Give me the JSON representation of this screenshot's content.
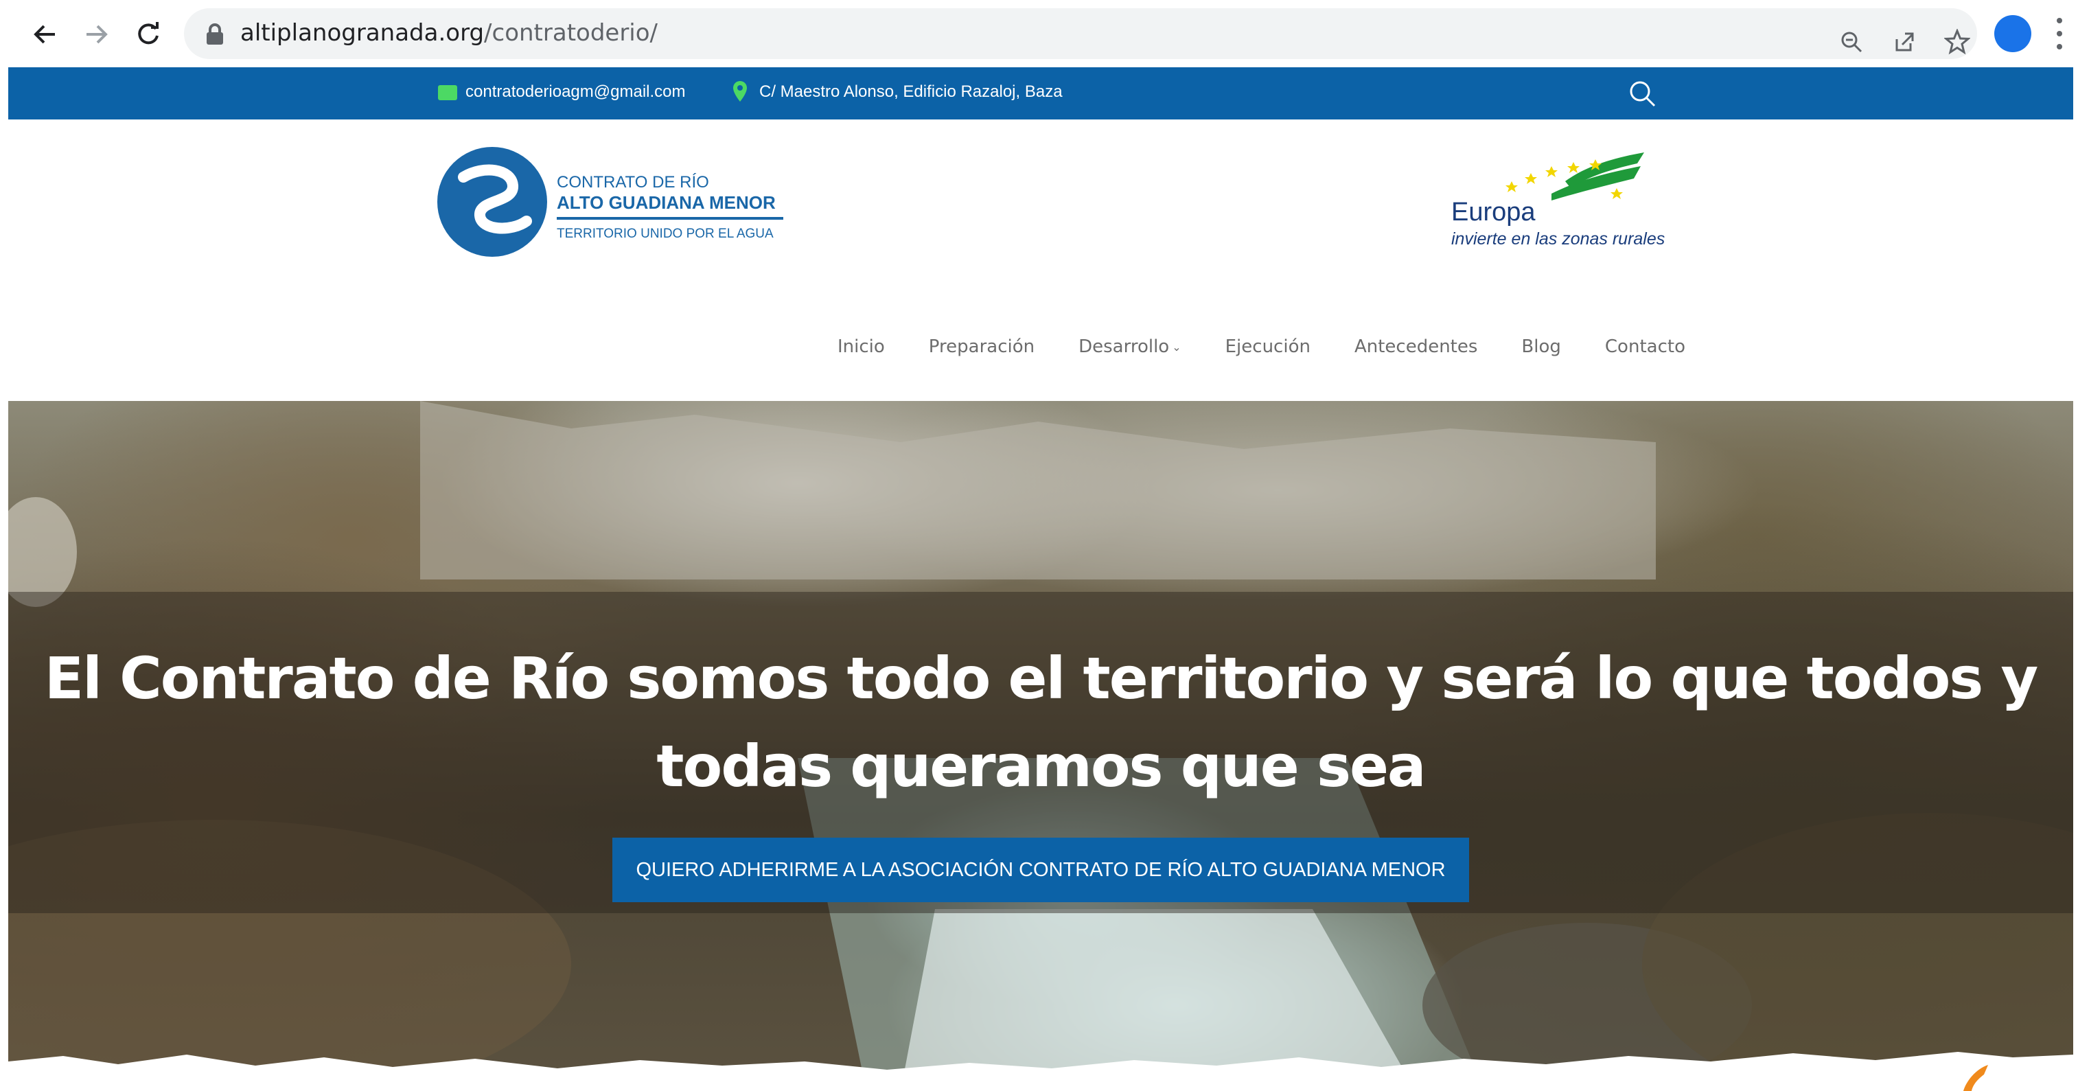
{
  "browser": {
    "url_host": "altiplanogranada.org",
    "url_path": "/contratoderio/",
    "icons": [
      "back-arrow-icon",
      "forward-arrow-icon",
      "reload-icon",
      "lock-icon",
      "zoom-icon",
      "share-icon",
      "star-icon",
      "profile-avatar",
      "menu-dots-icon"
    ]
  },
  "topbar": {
    "email": "contratoderioagm@gmail.com",
    "address": "C/ Maestro Alonso, Edificio Razaloj, Baza",
    "bg_color": "#0c62a7"
  },
  "logo": {
    "line1": "CONTRATO DE RÍO",
    "line2": "ALTO GUADIANA MENOR",
    "line3": "TERRITORIO UNIDO POR EL AGUA"
  },
  "eu_logo": {
    "word": "Europa",
    "tagline": "invierte en las zonas rurales"
  },
  "nav": {
    "items": [
      {
        "label": "Inicio"
      },
      {
        "label": "Preparación"
      },
      {
        "label": "Desarrollo"
      },
      {
        "label": "Ejecución"
      },
      {
        "label": "Antecedentes"
      },
      {
        "label": "Blog"
      },
      {
        "label": "Contacto"
      }
    ]
  },
  "hero": {
    "title_line1": "El Contrato de Río somos todo el territorio y será lo que todos y",
    "title_line2": "todas queramos que sea",
    "cta": "QUIERO ADHERIRME A LA ASOCIACIÓN CONTRATO DE RÍO ALTO GUADIANA MENOR"
  }
}
